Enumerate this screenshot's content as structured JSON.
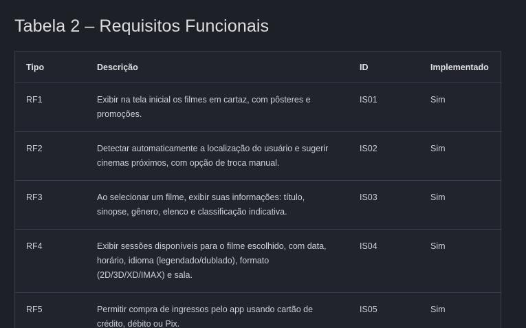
{
  "title": "Tabela 2 – Requisitos Funcionais",
  "table": {
    "headers": [
      "Tipo",
      "Descrição",
      "ID",
      "Implementado"
    ],
    "rows": [
      [
        "RF1",
        "Exibir na tela inicial os filmes em cartaz, com pôsteres e promoções.",
        "IS01",
        "Sim"
      ],
      [
        "RF2",
        "Detectar automaticamente a localização do usuário e sugerir cinemas próximos, com opção de troca manual.",
        "IS02",
        "Sim"
      ],
      [
        "RF3",
        "Ao selecionar um filme, exibir suas informações: título, sinopse, gênero, elenco e classificação indicativa.",
        "IS03",
        "Sim"
      ],
      [
        "RF4",
        "Exibir sessões disponíveis para o filme escolhido, com data, horário, idioma (legendado/dublado), formato (2D/3D/XD/IMAX) e sala.",
        "IS04",
        "Sim"
      ],
      [
        "RF5",
        "Permitir compra de ingressos pelo app usando cartão de crédito, débito ou Pix.",
        "IS05",
        "Sim"
      ]
    ]
  },
  "colors": {
    "background": "#1e2028",
    "border": "#3a3d47",
    "text": "#d2d3d8"
  }
}
